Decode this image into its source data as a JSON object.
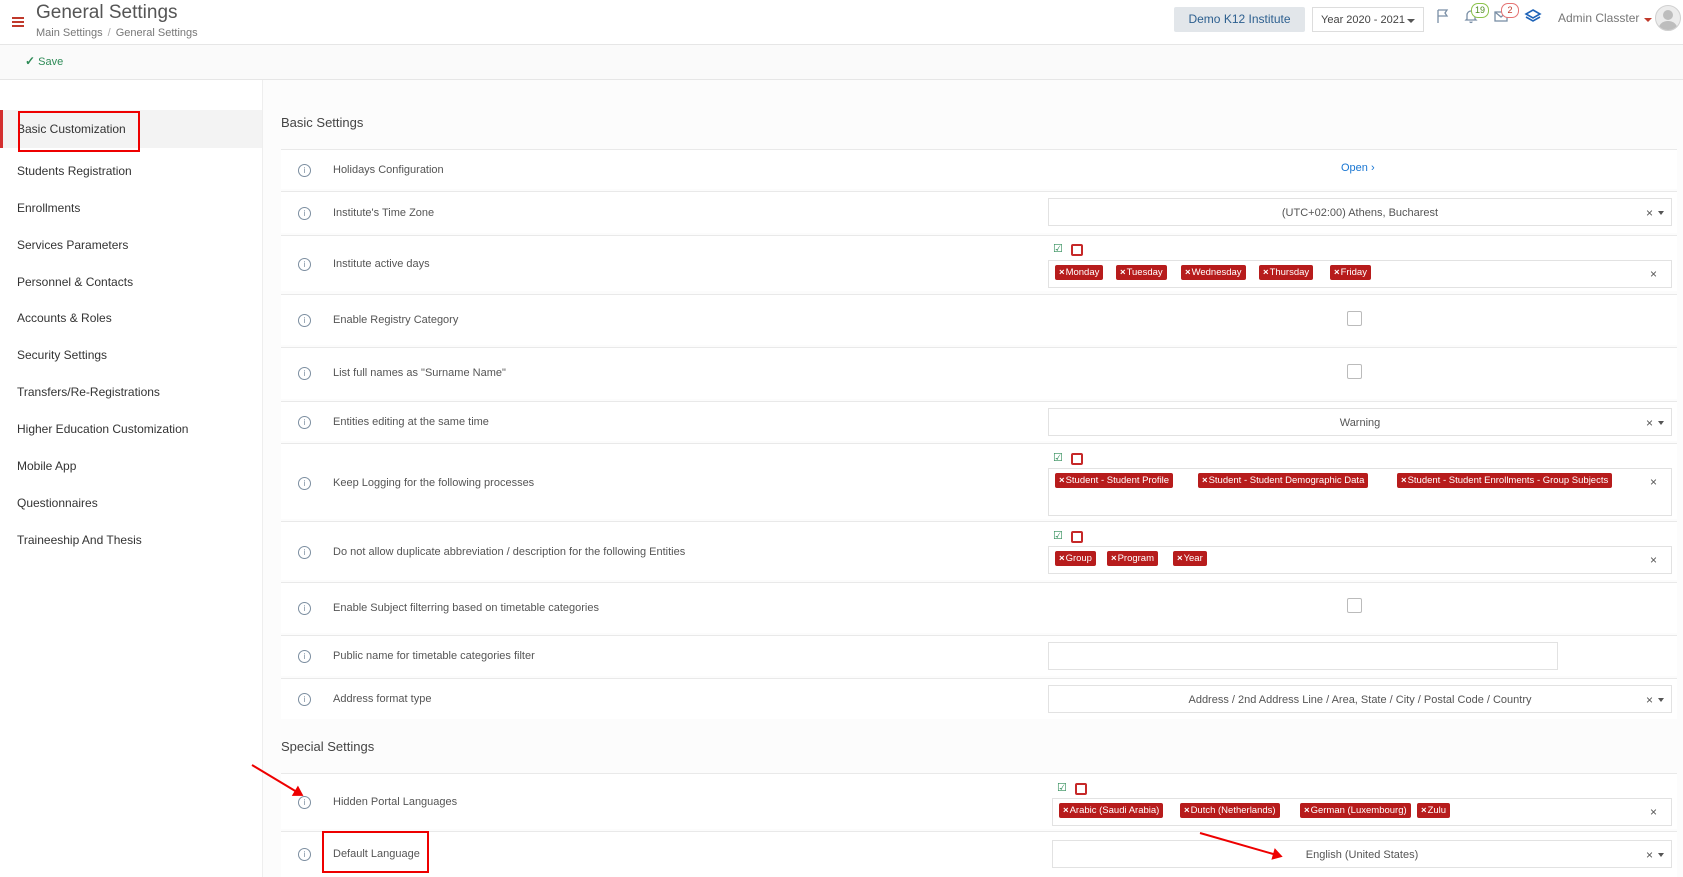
{
  "header": {
    "title": "General Settings",
    "breadcrumb": [
      "Main Settings",
      "General Settings"
    ],
    "institute": "Demo K12 Institute",
    "year": "Year 2020 - 2021",
    "notifications_count": "19",
    "messages_count": "2",
    "user_name": "Admin Classter"
  },
  "toolbar": {
    "save_label": "Save"
  },
  "sidebar": {
    "items": [
      {
        "label": "Basic Customization"
      },
      {
        "label": "Students Registration"
      },
      {
        "label": "Enrollments"
      },
      {
        "label": "Services Parameters"
      },
      {
        "label": "Personnel & Contacts"
      },
      {
        "label": "Accounts & Roles"
      },
      {
        "label": "Security Settings"
      },
      {
        "label": "Transfers/Re-Registrations"
      },
      {
        "label": "Higher Education Customization"
      },
      {
        "label": "Mobile App"
      },
      {
        "label": "Questionnaires"
      },
      {
        "label": "Traineeship And Thesis"
      }
    ]
  },
  "sections": {
    "basic_title": "Basic Settings",
    "special_title": "Special Settings"
  },
  "rows": {
    "holidays": {
      "label": "Holidays Configuration",
      "link": "Open"
    },
    "timezone": {
      "label": "Institute's Time Zone",
      "value": "(UTC+02:00) Athens, Bucharest"
    },
    "active_days": {
      "label": "Institute active days",
      "tags": [
        "Monday",
        "Tuesday",
        "Wednesday",
        "Thursday",
        "Friday"
      ]
    },
    "registry": {
      "label": "Enable Registry Category"
    },
    "surname": {
      "label": "List full names as \"Surname Name\""
    },
    "entities_editing": {
      "label": "Entities editing at the same time",
      "value": "Warning"
    },
    "logging": {
      "label": "Keep Logging for the following processes",
      "tags": [
        "Student - Student Profile",
        "Student - Student Demographic Data",
        "Student - Student Enrollments - Group Subjects"
      ]
    },
    "duplicate": {
      "label": "Do not allow duplicate abbreviation / description for the following Entities",
      "tags": [
        "Group",
        "Program",
        "Year"
      ]
    },
    "subject_filter": {
      "label": "Enable Subject filterring based on timetable categories"
    },
    "public_name": {
      "label": "Public name for timetable categories filter"
    },
    "address_format": {
      "label": "Address format type",
      "value": "Address / 2nd Address Line / Area, State / City / Postal Code / Country"
    },
    "hidden_langs": {
      "label": "Hidden Portal Languages",
      "tags": [
        "Arabic (Saudi Arabia)",
        "Dutch (Netherlands)",
        "German (Luxembourg)",
        "Zulu"
      ]
    },
    "default_lang": {
      "label": "Default Language",
      "value": "English (United States)"
    }
  },
  "icons": {
    "menu": "hamburger-icon",
    "flag": "flag-icon",
    "bell": "bell-icon",
    "mail": "mail-icon",
    "layers": "layers-icon",
    "info": "info-icon"
  },
  "colors": {
    "accent_red": "#b71c1c",
    "link_blue": "#1976d2",
    "save_green": "#2e8b57",
    "annotation_red": "#e00000"
  }
}
